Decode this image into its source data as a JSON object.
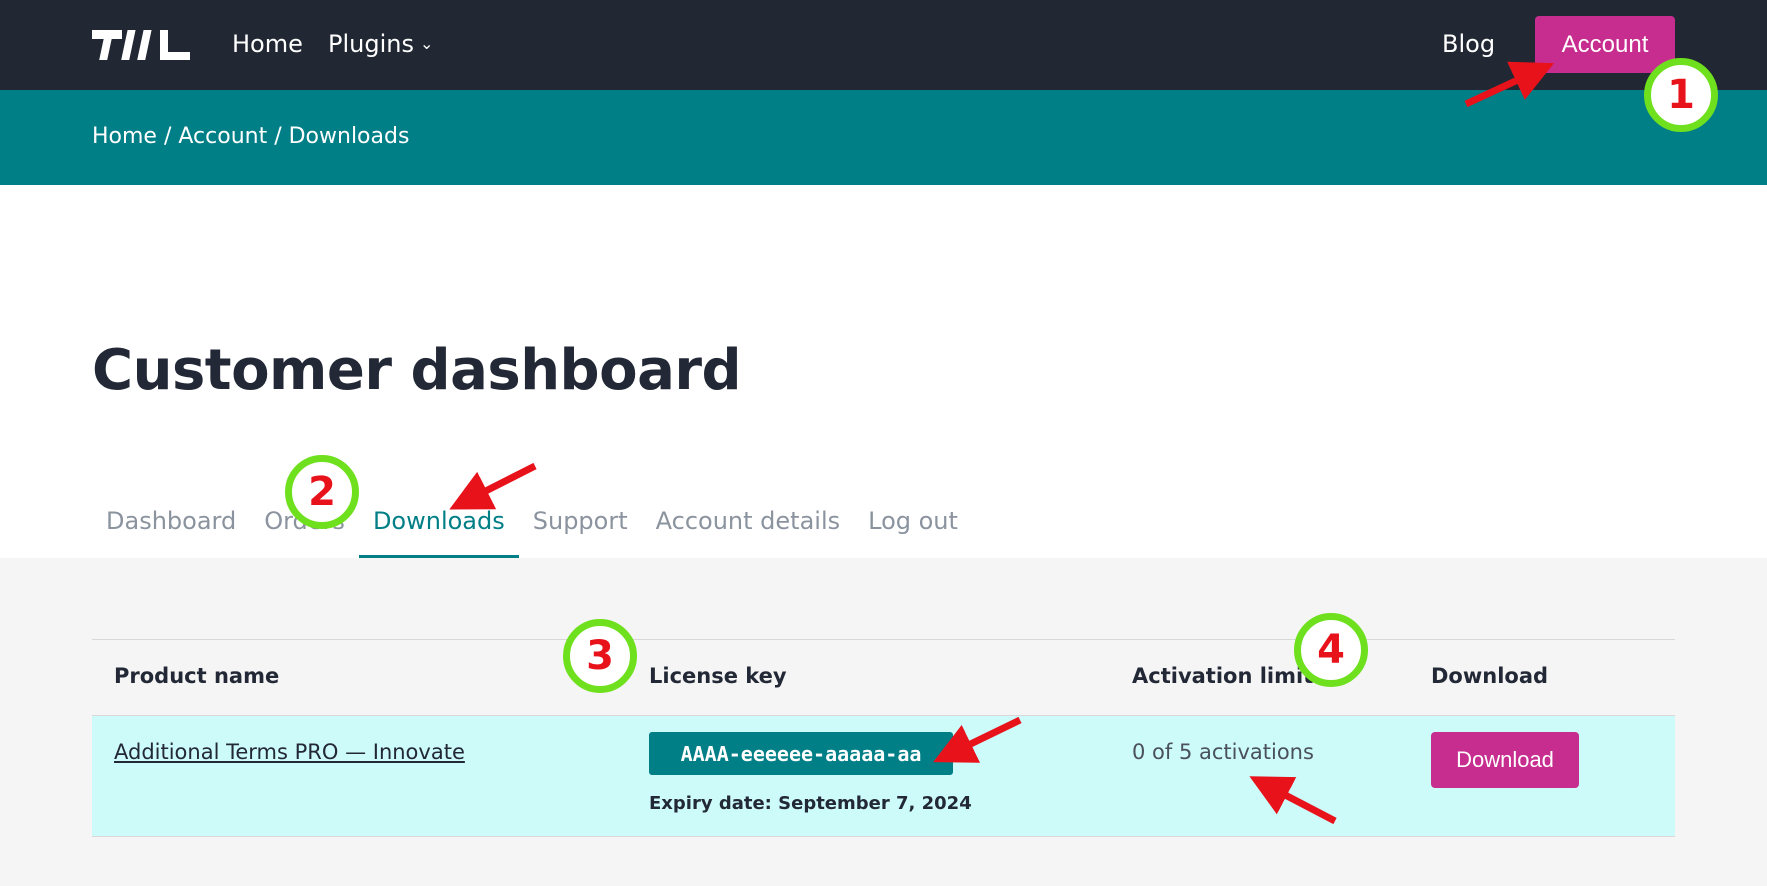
{
  "header": {
    "logo_icon": "brand-logo",
    "nav": {
      "home": "Home",
      "plugins": "Plugins",
      "plugins_icon": "chevron-down-icon",
      "blog": "Blog",
      "account": "Account"
    }
  },
  "breadcrumb": {
    "home": "Home",
    "sep1": " / ",
    "account": "Account",
    "sep2": " / ",
    "current": "Downloads"
  },
  "page": {
    "title": "Customer dashboard"
  },
  "tabs": [
    {
      "label": "Dashboard",
      "active": false
    },
    {
      "label": "Orders",
      "active": false
    },
    {
      "label": "Downloads",
      "active": true
    },
    {
      "label": "Support",
      "active": false
    },
    {
      "label": "Account details",
      "active": false
    },
    {
      "label": "Log out",
      "active": false
    }
  ],
  "downloads_table": {
    "headers": {
      "product_name": "Product name",
      "license_key": "License key",
      "activation_limit": "Activation limit",
      "download": "Download"
    },
    "rows": [
      {
        "product": "Additional Terms PRO — Innovate",
        "license_key": "AAAA-eeeeee-aaaaa-aa",
        "expiry": "Expiry date: September 7, 2024",
        "activations": "0 of 5 activations",
        "download_label": "Download"
      }
    ]
  },
  "annotations": {
    "step1": "1",
    "step2": "2",
    "step3": "3",
    "step4": "4",
    "circle_color": "#6ee01d",
    "arrow_color": "#e8121b"
  },
  "colors": {
    "topbar": "#222833",
    "teal": "#007f87",
    "magenta": "#c62d8f",
    "row_highlight": "#cdfbfa"
  }
}
